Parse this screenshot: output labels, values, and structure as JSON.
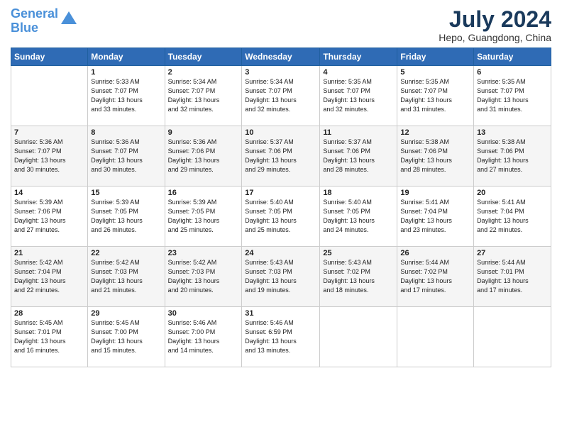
{
  "logo": {
    "line1": "General",
    "line2": "Blue"
  },
  "title": "July 2024",
  "location": "Hepo, Guangdong, China",
  "days_header": [
    "Sunday",
    "Monday",
    "Tuesday",
    "Wednesday",
    "Thursday",
    "Friday",
    "Saturday"
  ],
  "weeks": [
    [
      {
        "num": "",
        "info": ""
      },
      {
        "num": "1",
        "info": "Sunrise: 5:33 AM\nSunset: 7:07 PM\nDaylight: 13 hours\nand 33 minutes."
      },
      {
        "num": "2",
        "info": "Sunrise: 5:34 AM\nSunset: 7:07 PM\nDaylight: 13 hours\nand 32 minutes."
      },
      {
        "num": "3",
        "info": "Sunrise: 5:34 AM\nSunset: 7:07 PM\nDaylight: 13 hours\nand 32 minutes."
      },
      {
        "num": "4",
        "info": "Sunrise: 5:35 AM\nSunset: 7:07 PM\nDaylight: 13 hours\nand 32 minutes."
      },
      {
        "num": "5",
        "info": "Sunrise: 5:35 AM\nSunset: 7:07 PM\nDaylight: 13 hours\nand 31 minutes."
      },
      {
        "num": "6",
        "info": "Sunrise: 5:35 AM\nSunset: 7:07 PM\nDaylight: 13 hours\nand 31 minutes."
      }
    ],
    [
      {
        "num": "7",
        "info": "Sunrise: 5:36 AM\nSunset: 7:07 PM\nDaylight: 13 hours\nand 30 minutes."
      },
      {
        "num": "8",
        "info": "Sunrise: 5:36 AM\nSunset: 7:07 PM\nDaylight: 13 hours\nand 30 minutes."
      },
      {
        "num": "9",
        "info": "Sunrise: 5:36 AM\nSunset: 7:06 PM\nDaylight: 13 hours\nand 29 minutes."
      },
      {
        "num": "10",
        "info": "Sunrise: 5:37 AM\nSunset: 7:06 PM\nDaylight: 13 hours\nand 29 minutes."
      },
      {
        "num": "11",
        "info": "Sunrise: 5:37 AM\nSunset: 7:06 PM\nDaylight: 13 hours\nand 28 minutes."
      },
      {
        "num": "12",
        "info": "Sunrise: 5:38 AM\nSunset: 7:06 PM\nDaylight: 13 hours\nand 28 minutes."
      },
      {
        "num": "13",
        "info": "Sunrise: 5:38 AM\nSunset: 7:06 PM\nDaylight: 13 hours\nand 27 minutes."
      }
    ],
    [
      {
        "num": "14",
        "info": "Sunrise: 5:39 AM\nSunset: 7:06 PM\nDaylight: 13 hours\nand 27 minutes."
      },
      {
        "num": "15",
        "info": "Sunrise: 5:39 AM\nSunset: 7:05 PM\nDaylight: 13 hours\nand 26 minutes."
      },
      {
        "num": "16",
        "info": "Sunrise: 5:39 AM\nSunset: 7:05 PM\nDaylight: 13 hours\nand 25 minutes."
      },
      {
        "num": "17",
        "info": "Sunrise: 5:40 AM\nSunset: 7:05 PM\nDaylight: 13 hours\nand 25 minutes."
      },
      {
        "num": "18",
        "info": "Sunrise: 5:40 AM\nSunset: 7:05 PM\nDaylight: 13 hours\nand 24 minutes."
      },
      {
        "num": "19",
        "info": "Sunrise: 5:41 AM\nSunset: 7:04 PM\nDaylight: 13 hours\nand 23 minutes."
      },
      {
        "num": "20",
        "info": "Sunrise: 5:41 AM\nSunset: 7:04 PM\nDaylight: 13 hours\nand 22 minutes."
      }
    ],
    [
      {
        "num": "21",
        "info": "Sunrise: 5:42 AM\nSunset: 7:04 PM\nDaylight: 13 hours\nand 22 minutes."
      },
      {
        "num": "22",
        "info": "Sunrise: 5:42 AM\nSunset: 7:03 PM\nDaylight: 13 hours\nand 21 minutes."
      },
      {
        "num": "23",
        "info": "Sunrise: 5:42 AM\nSunset: 7:03 PM\nDaylight: 13 hours\nand 20 minutes."
      },
      {
        "num": "24",
        "info": "Sunrise: 5:43 AM\nSunset: 7:03 PM\nDaylight: 13 hours\nand 19 minutes."
      },
      {
        "num": "25",
        "info": "Sunrise: 5:43 AM\nSunset: 7:02 PM\nDaylight: 13 hours\nand 18 minutes."
      },
      {
        "num": "26",
        "info": "Sunrise: 5:44 AM\nSunset: 7:02 PM\nDaylight: 13 hours\nand 17 minutes."
      },
      {
        "num": "27",
        "info": "Sunrise: 5:44 AM\nSunset: 7:01 PM\nDaylight: 13 hours\nand 17 minutes."
      }
    ],
    [
      {
        "num": "28",
        "info": "Sunrise: 5:45 AM\nSunset: 7:01 PM\nDaylight: 13 hours\nand 16 minutes."
      },
      {
        "num": "29",
        "info": "Sunrise: 5:45 AM\nSunset: 7:00 PM\nDaylight: 13 hours\nand 15 minutes."
      },
      {
        "num": "30",
        "info": "Sunrise: 5:46 AM\nSunset: 7:00 PM\nDaylight: 13 hours\nand 14 minutes."
      },
      {
        "num": "31",
        "info": "Sunrise: 5:46 AM\nSunset: 6:59 PM\nDaylight: 13 hours\nand 13 minutes."
      },
      {
        "num": "",
        "info": ""
      },
      {
        "num": "",
        "info": ""
      },
      {
        "num": "",
        "info": ""
      }
    ]
  ]
}
